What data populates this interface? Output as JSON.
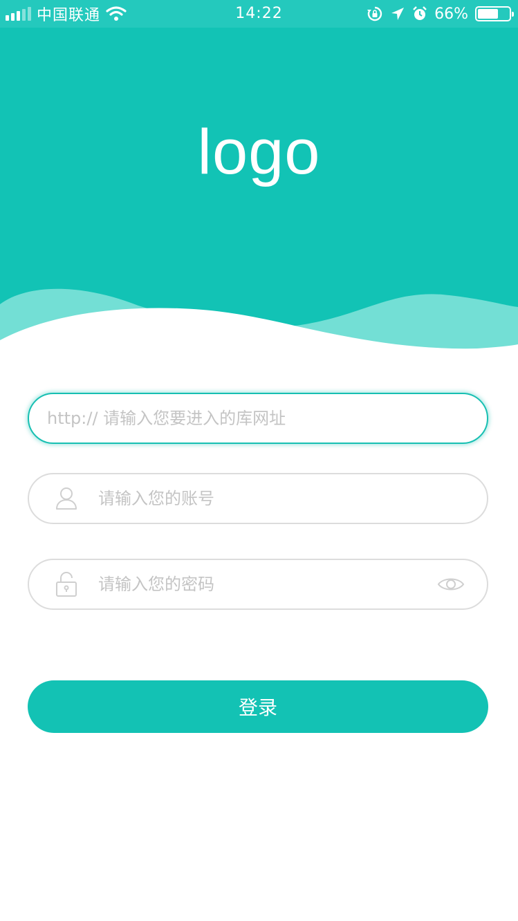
{
  "status_bar": {
    "carrier": "中国联通",
    "time": "14:22",
    "battery_percent": "66%",
    "battery_level": 0.66
  },
  "header": {
    "logo_text": "logo"
  },
  "form": {
    "url_placeholder": "http:// 请输入您要进入的库网址",
    "account_placeholder": "请输入您的账号",
    "password_placeholder": "请输入您的密码",
    "login_label": "登录"
  },
  "icons": {
    "account": "user-icon",
    "password": "lock-icon",
    "toggle_visibility": "eye-icon"
  },
  "colors": {
    "primary": "#12c3b5",
    "wave_light": "#73dfd5",
    "border": "#dcdcdc",
    "placeholder": "#c4c4c4"
  }
}
